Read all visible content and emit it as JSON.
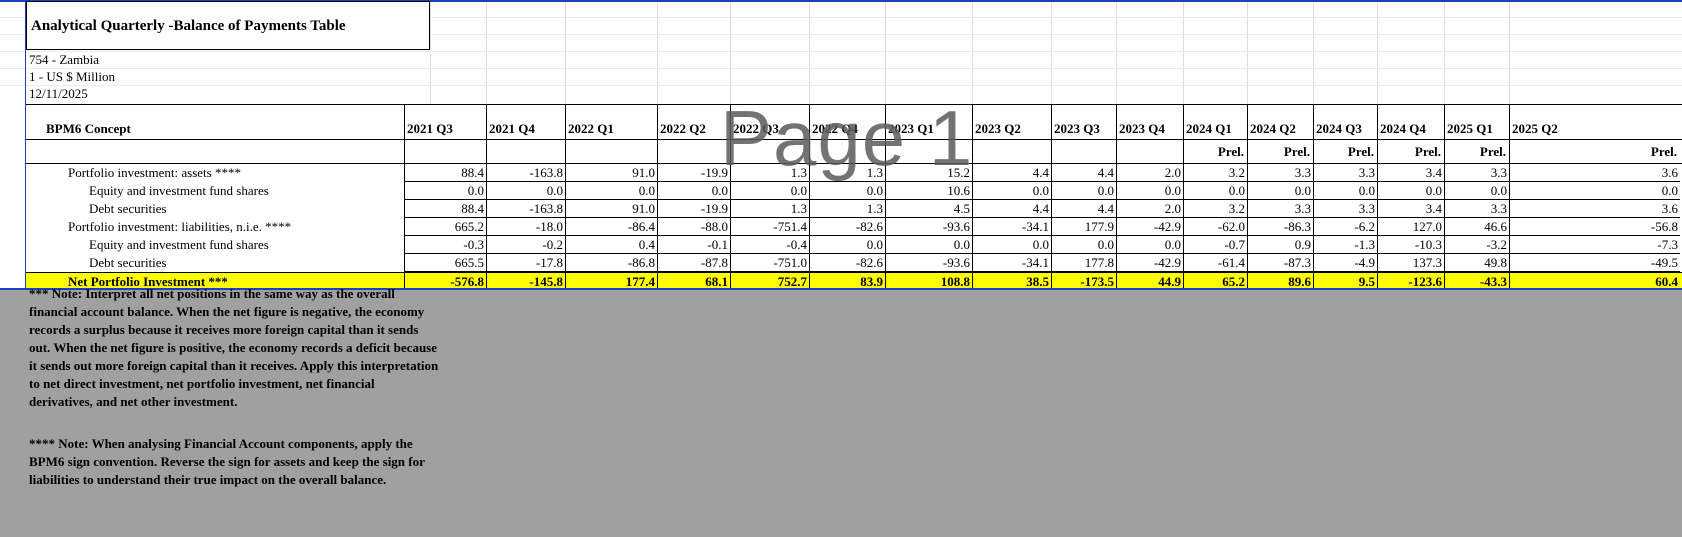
{
  "sheet": {
    "title": "Analytical Quarterly -Balance of Payments Table",
    "country": "754 - Zambia",
    "unit": "1 - US $ Million",
    "date": "12/11/2025",
    "watermark": "Page 1"
  },
  "table": {
    "concept_header": "BPM6 Concept",
    "columns": [
      "2021 Q3",
      "2021 Q4",
      "2022 Q1",
      "2022 Q2",
      "2022 Q3",
      "2022 Q4",
      "2023 Q1",
      "2023 Q2",
      "2023 Q3",
      "2023 Q4",
      "2024 Q1",
      "2024 Q2",
      "2024 Q3",
      "2024 Q4",
      "2025 Q1",
      "2025 Q2"
    ],
    "prel": [
      "",
      "",
      "",
      "",
      "",
      "",
      "",
      "",
      "",
      "",
      "Prel.",
      "Prel.",
      "Prel.",
      "Prel.",
      "Prel.",
      "Prel."
    ],
    "rows": [
      {
        "label": "Portfolio investment: assets ****",
        "values": [
          "88.4",
          "-163.8",
          "91.0",
          "-19.9",
          "1.3",
          "1.3",
          "15.2",
          "4.4",
          "4.4",
          "2.0",
          "3.2",
          "3.3",
          "3.3",
          "3.4",
          "3.3",
          "3.6"
        ]
      },
      {
        "label": "Equity and investment fund shares",
        "values": [
          "0.0",
          "0.0",
          "0.0",
          "0.0",
          "0.0",
          "0.0",
          "10.6",
          "0.0",
          "0.0",
          "0.0",
          "0.0",
          "0.0",
          "0.0",
          "0.0",
          "0.0",
          "0.0"
        ]
      },
      {
        "label": "Debt securities",
        "values": [
          "88.4",
          "-163.8",
          "91.0",
          "-19.9",
          "1.3",
          "1.3",
          "4.5",
          "4.4",
          "4.4",
          "2.0",
          "3.2",
          "3.3",
          "3.3",
          "3.4",
          "3.3",
          "3.6"
        ]
      },
      {
        "label": "Portfolio investment: liabilities, n.i.e. ****",
        "values": [
          "665.2",
          "-18.0",
          "-86.4",
          "-88.0",
          "-751.4",
          "-82.6",
          "-93.6",
          "-34.1",
          "177.9",
          "-42.9",
          "-62.0",
          "-86.3",
          "-6.2",
          "127.0",
          "46.6",
          "-56.8"
        ]
      },
      {
        "label": "Equity and investment fund shares",
        "values": [
          "-0.3",
          "-0.2",
          "0.4",
          "-0.1",
          "-0.4",
          "0.0",
          "0.0",
          "0.0",
          "0.0",
          "0.0",
          "-0.7",
          "0.9",
          "-1.3",
          "-10.3",
          "-3.2",
          "-7.3"
        ]
      },
      {
        "label": "Debt securities",
        "values": [
          "665.5",
          "-17.8",
          "-86.8",
          "-87.8",
          "-751.0",
          "-82.6",
          "-93.6",
          "-34.1",
          "177.8",
          "-42.9",
          "-61.4",
          "-87.3",
          "-4.9",
          "137.3",
          "49.8",
          "-49.5"
        ]
      },
      {
        "label": "Net Portfolio Investment ***",
        "values": [
          "-576.8",
          "-145.8",
          "177.4",
          "68.1",
          "752.7",
          "83.9",
          "108.8",
          "38.5",
          "-173.5",
          "44.9",
          "65.2",
          "89.6",
          "9.5",
          "-123.6",
          "-43.3",
          "60.4"
        ]
      }
    ]
  },
  "notes": {
    "note1": "*** Note: Interpret all net positions in the same way as the overall financial account balance. When the net figure is negative, the economy records a surplus because it receives more foreign capital than it sends out. When the net figure is positive, the economy records a deficit because it sends out more foreign capital than it receives. Apply this interpretation to net direct investment, net portfolio investment, net financial derivatives, and net other investment.",
    "note2": "**** Note: When analysing Financial Account components, apply the BPM6 sign convention. Reverse the sign for assets and keep the sign for liabilities to understand their true impact on the overall balance."
  },
  "colors": {
    "highlight": "#ffff00",
    "gray_area": "#a0a0a0",
    "border_blue": "#1f3fbf"
  }
}
